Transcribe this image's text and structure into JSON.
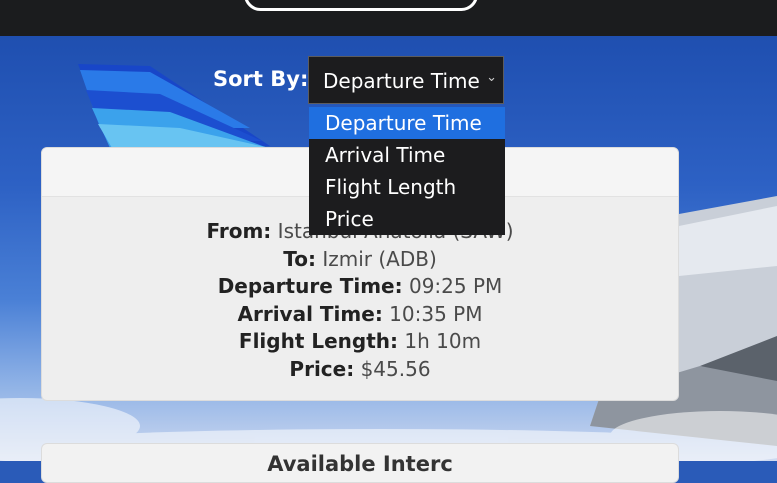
{
  "sort": {
    "label": "Sort By:",
    "selected": "Departure Time",
    "options": [
      "Departure Time",
      "Arrival Time",
      "Flight Length",
      "Price"
    ]
  },
  "flight": {
    "from_label": "From:",
    "from_value": "Istanbul Anatolia (SAW)",
    "to_label": "To:",
    "to_value": "Izmir (ADB)",
    "departure_label": "Departure Time:",
    "departure_value": "09:25 PM",
    "arrival_label": "Arrival Time:",
    "arrival_value": "10:35 PM",
    "length_label": "Flight Length:",
    "length_value": "1h 10m",
    "price_label": "Price:",
    "price_value": "$45.56"
  },
  "next_card": {
    "title": "Available Interc"
  },
  "colors": {
    "topbar": "#1b1c1e",
    "selected_option": "#1f6fe0",
    "sky": "#2d61c4"
  }
}
